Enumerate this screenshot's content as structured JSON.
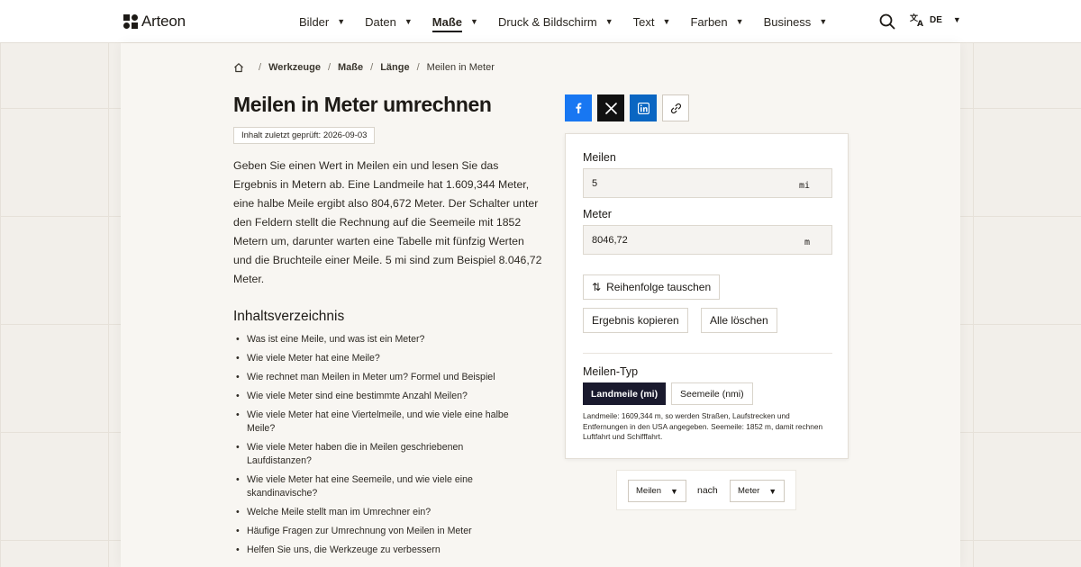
{
  "app": {
    "name": "Arteon"
  },
  "nav": {
    "items": [
      {
        "label": "Bilder",
        "active": false
      },
      {
        "label": "Daten",
        "active": false
      },
      {
        "label": "Maße",
        "active": true
      },
      {
        "label": "Druck & Bildschirm",
        "active": false
      },
      {
        "label": "Text",
        "active": false
      },
      {
        "label": "Farben",
        "active": false
      },
      {
        "label": "Business",
        "active": false
      }
    ],
    "lang": "DE"
  },
  "breadcrumb": {
    "items": [
      "Werkzeuge",
      "Maße",
      "Länge"
    ],
    "current": "Meilen in Meter",
    "separator": "/"
  },
  "page": {
    "title": "Meilen in Meter umrechnen",
    "updated": "Inhalt zuletzt geprüft: 2026-09-03",
    "intro": "Geben Sie einen Wert in Meilen ein und lesen Sie das Ergebnis in Metern ab. Eine Landmeile hat 1.609,344 Meter, eine halbe Meile ergibt also 804,672 Meter. Der Schalter unter den Feldern stellt die Rechnung auf die Seemeile mit 1852 Metern um, darunter warten eine Tabelle mit fünfzig Werten und die Bruchteile einer Meile. 5 mi sind zum Beispiel 8.046,72 Meter."
  },
  "toc": {
    "title": "Inhaltsverzeichnis",
    "items": [
      "Was ist eine Meile, und was ist ein Meter?",
      "Wie viele Meter hat eine Meile?",
      "Wie rechnet man Meilen in Meter um? Formel und Beispiel",
      "Wie viele Meter sind eine bestimmte Anzahl Meilen?",
      "Wie viele Meter hat eine Viertelmeile, und wie viele eine halbe Meile?",
      "Wie viele Meter haben die in Meilen geschriebenen Laufdistanzen?",
      "Wie viele Meter hat eine Seemeile, und wie viele eine skandinavische?",
      "Welche Meile stellt man im Umrechner ein?",
      "Häufige Fragen zur Umrechnung von Meilen in Meter",
      "Helfen Sie uns, die Werkzeuge zu verbessern"
    ]
  },
  "converter": {
    "from": {
      "label": "Meilen",
      "value": "5",
      "unit": "mi"
    },
    "to": {
      "label": "Meter",
      "value": "8046,72",
      "unit": "m"
    },
    "swap_label": "Reihenfolge tauschen",
    "copy_label": "Ergebnis kopieren",
    "clear_label": "Alle löschen",
    "type_label": "Meilen-Typ",
    "type_options": [
      "Landmeile (mi)",
      "Seemeile (nmi)"
    ],
    "type_selected": "Landmeile (mi)",
    "note": "Landmeile: 1609,344 m, so werden Straßen, Laufstrecken und Entfernungen in den USA angegeben. Seemeile: 1852 m, damit rechnen Luftfahrt und Schifffahrt."
  },
  "unit_selector": {
    "from": "Meilen",
    "connector": "nach",
    "to": "Meter"
  },
  "colors": {
    "facebook": "#1877f2",
    "x": "#111111",
    "linkedin": "#0a66c2",
    "segment_active": "#1a1a2e"
  },
  "icons": {
    "share": [
      "facebook-icon",
      "x-icon",
      "linkedin-icon",
      "link-icon"
    ],
    "header": [
      "search-icon",
      "translate-icon"
    ],
    "breadcrumb_home": "home-icon"
  }
}
